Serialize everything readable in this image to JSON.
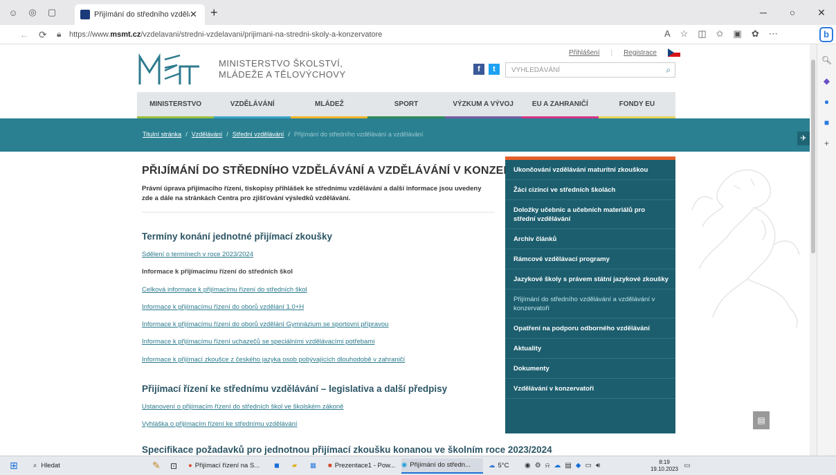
{
  "browser": {
    "tab_title": "Přijímání do středního vzdělávání",
    "url_prefix": "https://www.",
    "url_domain": "msmt.cz",
    "url_path": "/vzdelavani/stredni-vzdelavani/prijimani-na-stredni-skoly-a-konzervatore",
    "bing_label": "b"
  },
  "site": {
    "ministry_line1": "MINISTERSTVO ŠKOLSTVÍ,",
    "ministry_line2": "MLÁDEŽE A TĚLOVÝCHOVY",
    "login": "Přihlášení",
    "register": "Registrace",
    "search_placeholder": "VYHLEDÁVÁNÍ",
    "nav": [
      {
        "label": "MINISTERSTVO",
        "color": "#9bbf3c"
      },
      {
        "label": "VZDĚLÁVÁNÍ",
        "color": "#3fa4c8"
      },
      {
        "label": "MLÁDEŽ",
        "color": "#f0b429"
      },
      {
        "label": "SPORT",
        "color": "#2e8b57"
      },
      {
        "label": "VÝZKUM A VÝVOJ",
        "color": "#7a5aa8"
      },
      {
        "label": "EU A ZAHRANIČÍ",
        "color": "#d63384"
      },
      {
        "label": "FONDY EU",
        "color": "#e8d35a"
      }
    ],
    "breadcrumb": {
      "home": "Titulní stránka",
      "sep": "/",
      "level1": "Vzdělávání",
      "level2": "Střední vzdělávání",
      "current": "Přijímání do středního vzdělávání a vzdělávání"
    }
  },
  "main": {
    "title": "PŘIJÍMÁNÍ DO STŘEDNÍHO VZDĚLÁVÁNÍ A VZDĚLÁVÁNÍ V KONZERVATOŘI",
    "intro": "Právní úprava přijímacího řízení, tiskopisy přihlášek ke střednímu vzdělávání a další informace jsou uvedeny zde a dále na stránkách Centra pro zjišťování výsledků vzdělávání.",
    "section1": "Termíny konání jednotné přijímací zkoušky",
    "s1_link1": "Sdělení o termínech v roce 2023/2024",
    "s1_text": "Informace k přijímacímu řízení do středních škol",
    "s1_links": [
      "Celková informace k přijímacímu řízení do středních škol",
      "Informace k přijímacímu řízení do oborů vzdělání 1.0+H",
      "Informace k přijímacímu řízení do oborů vzdělání Gymnázium se sportovní přípravou",
      "Informace k přijímacímu řízení uchazečů se speciálními vzdělávacími potřebami",
      "Informace k přijímací zkoušce z českého jazyka osob pobývajících dlouhodobě v zahraničí"
    ],
    "section2": "Přijímací řízení ke střednímu vzdělávání – legislativa a další předpisy",
    "s2_links": [
      "Ustanovení o přijímacím řízení do středních škol ve školském zákoně",
      "Vyhláška o přijímacím řízení ke střednímu vzdělávání"
    ],
    "section3": "Specifikace požadavků pro jednotnou přijímací zkoušku konanou ve školním roce 2023/2024"
  },
  "sidebar": [
    "Ukončování vzdělávání maturitní zkouškou",
    "Žáci cizinci ve středních školách",
    "Doložky učebnic a učebních materiálů pro střední vzdělávání",
    "Archiv článků",
    "Rámcové vzdělávací programy",
    "Jazykové školy s právem státní jazykové zkoušky",
    "Přijímání do středního vzdělávání a vzdělávání v konzervatoři",
    "Opatření na podporu odborného vzdělávání",
    "Aktuality",
    "Dokumenty",
    "Vzdělávání v konzervatoři"
  ],
  "taskbar": {
    "search": "Hledat",
    "apps": [
      "Přijímací řízení na S...",
      "Prezentace1 - Pow...",
      "Přijímání do středn..."
    ],
    "weather": "5°C",
    "time": "8:19",
    "date": "19.10.2023"
  }
}
